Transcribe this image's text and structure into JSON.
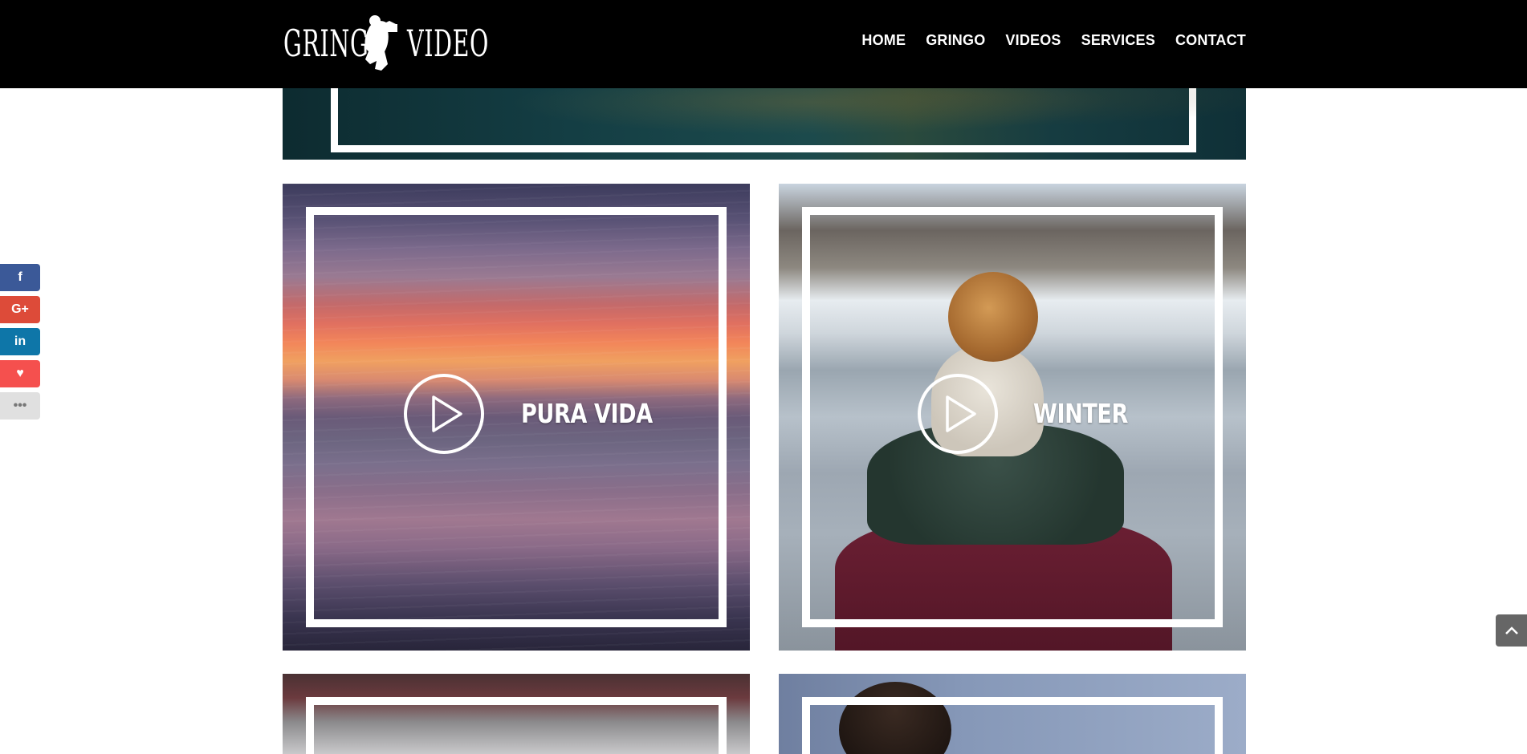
{
  "header": {
    "logo": {
      "word1": "GRINGO",
      "word2": "VIDEO"
    },
    "nav": [
      {
        "label": "HOME"
      },
      {
        "label": "GRINGO"
      },
      {
        "label": "VIDEOS"
      },
      {
        "label": "SERVICES"
      },
      {
        "label": "CONTACT"
      }
    ]
  },
  "videos": [
    {
      "title": "PURA VIDA"
    },
    {
      "title": "WINTER"
    }
  ],
  "social": {
    "items": [
      {
        "name": "facebook",
        "glyph": "f"
      },
      {
        "name": "google-plus",
        "glyph": "G+"
      },
      {
        "name": "linkedin",
        "glyph": "in"
      },
      {
        "name": "favorite",
        "glyph": "♥"
      },
      {
        "name": "more",
        "glyph": "•••"
      }
    ]
  },
  "colors": {
    "header_bg": "#000000",
    "facebook": "#3b5998",
    "google_plus": "#dd4b39",
    "linkedin": "#0e76a8",
    "favorite": "#f5504e"
  }
}
